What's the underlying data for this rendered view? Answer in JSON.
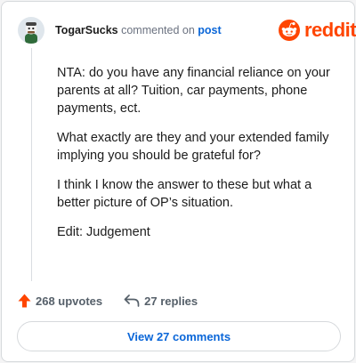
{
  "comment": {
    "username": "TogarSucks",
    "commented_on_text": "commented on",
    "post_link": "post",
    "brand": "reddit",
    "paragraphs": [
      "NTA: do you have any financial reliance on your parents at all? Tuition, car payments, phone payments, ect.",
      "What exactly are they and your extended family implying you should be grateful for?",
      "I think I know the answer to these but what a better picture of OP’s situation.",
      "Edit: Judgement"
    ]
  },
  "actions": {
    "upvotes": "268 upvotes",
    "replies": "27 replies",
    "view_comments": "View 27 comments"
  },
  "colors": {
    "brand": "#ff4500",
    "link": "#0a66d8",
    "text": "#1c1c1c",
    "muted": "#6b7280"
  },
  "icons": {
    "avatar": "avatar-icon",
    "brand_logo": "reddit-snoo-icon",
    "upvote": "upvote-arrow-icon",
    "reply": "reply-arrow-icon"
  }
}
